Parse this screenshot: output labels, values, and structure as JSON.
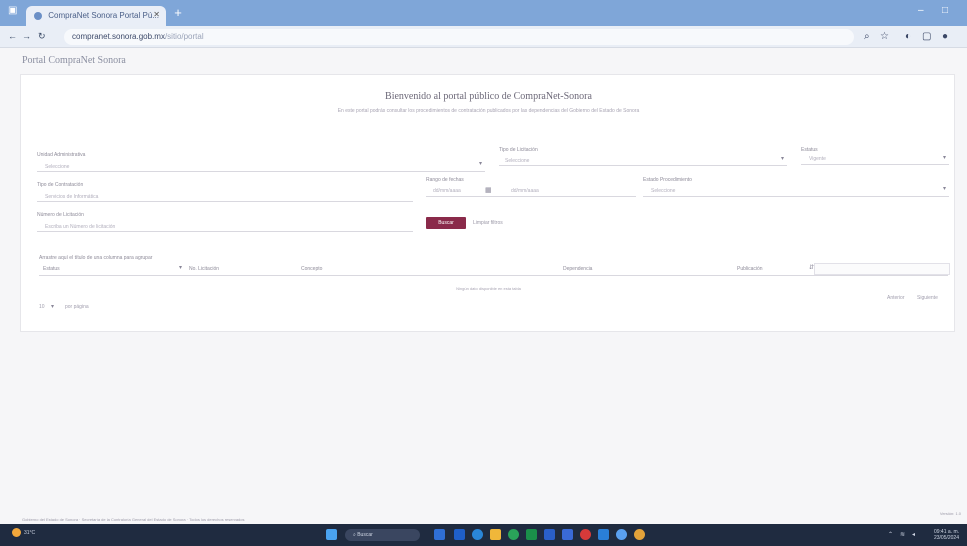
{
  "browser": {
    "tab_title": "CompraNet Sonora Portal Pú...",
    "url_host": "compranet.sonora.gob.mx",
    "url_path": "/sitio/portal"
  },
  "page": {
    "portal_name": "Portal CompraNet Sonora",
    "welcome": "Bienvenido al portal público de CompraNet-Sonora",
    "welcome_sub": "En este portal podrás consultar los procedimientos de contratación publicados por las dependencias del Gobierno del Estado de Sonora"
  },
  "form": {
    "unidad_label": "Unidad Administrativa",
    "unidad_value": "Seleccione",
    "tipo_label": "Tipo de Licitación",
    "tipo_value": "Seleccione",
    "estatus_label": "Estatus",
    "estatus_value": "Vigente",
    "tipo_contratacion_label": "Tipo de Contratación",
    "tipo_contratacion_value": "Servicios de Informática",
    "rango_label": "Rango de fechas",
    "fecha_inicio": "dd/mm/aaaa",
    "fecha_fin": "dd/mm/aaaa",
    "estado_label": "Estado Procedimiento",
    "estado_value": "Seleccione",
    "numero_label": "Número de Licitación",
    "numero_placeholder": "Escriba un Número de licitación",
    "buscar_label": "Buscar",
    "limpiar_label": "Limpiar filtros"
  },
  "table": {
    "drag_hint": "Arrastre aquí el título de una columna para agrupar",
    "columns": [
      "Estatus",
      "No. Licitación",
      "Concepto",
      "Dependencia",
      "Publicación"
    ],
    "empty": "Ningún dato disponible en esta tabla",
    "page_size": "10",
    "page_size_suffix": "por página",
    "prev": "Anterior",
    "next": "Siguiente"
  },
  "footer": {
    "left": "Gobierno del Estado de Sonora · Secretaría de la Contraloría General del Estado de Sonora · Todos los derechos reservados",
    "right": "Versión: 1.0"
  },
  "taskbar": {
    "weather_temp": "31°C",
    "weather_desc": "Soleado",
    "search_label": "Buscar",
    "time": "09:41 a. m.",
    "date": "23/05/2024"
  },
  "colors": {
    "accent": "#8a2a4a",
    "chrome": "#7fa6d8",
    "taskbar": "#1f2b40"
  }
}
